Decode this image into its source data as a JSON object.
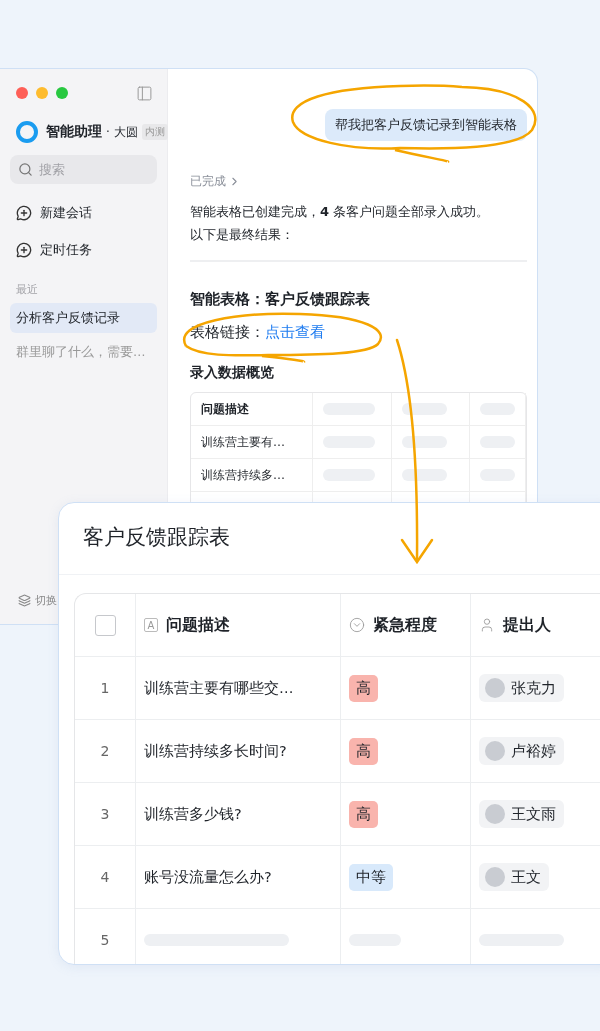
{
  "sidebar": {
    "app_name": "智能助理",
    "user": "· 大圆",
    "badge": "内测",
    "search": {
      "placeholder": "搜索"
    },
    "actions": [
      {
        "label": "新建会话"
      },
      {
        "label": "定时任务"
      }
    ],
    "section_title": "最近",
    "conversations": [
      {
        "label": "分析客户反馈记录",
        "selected": true
      },
      {
        "label": "群里聊了什么，需要…",
        "selected": false
      }
    ],
    "footer": "切换"
  },
  "chat": {
    "user_message": "帮我把客户反馈记录到智能表格",
    "status": "已完成",
    "reply_lines": [
      "智能表格已创建完成，**4** 条客户问题全部录入成功。",
      "以下是最终结果："
    ],
    "table_title": "智能表格：客户反馈跟踪表",
    "link_label": "表格链接：",
    "link_text": "点击查看",
    "overview_title": "录入数据概览",
    "overview_table": {
      "columns": [
        "问题描述"
      ],
      "rows": [
        "训练营主要有…",
        "训练营持续多…"
      ]
    }
  },
  "sheet": {
    "title": "客户反馈跟踪表",
    "select_all": {
      "checked": false
    },
    "columns": [
      {
        "label": "问题描述",
        "kind": "text",
        "type_glyph": "A"
      },
      {
        "label": "紧急程度",
        "kind": "select"
      },
      {
        "label": "提出人",
        "kind": "person"
      }
    ],
    "rows": [
      {
        "index": "1",
        "description": "训练营主要有哪些交…",
        "urgency": {
          "label": "高",
          "color": "#f9b4ad"
        },
        "person": "张克力"
      },
      {
        "index": "2",
        "description": "训练营持续多长时间?",
        "urgency": {
          "label": "高",
          "color": "#f9b4ad"
        },
        "person": "卢裕婷"
      },
      {
        "index": "3",
        "description": "训练营多少钱?",
        "urgency": {
          "label": "高",
          "color": "#f9b4ad"
        },
        "person": "王文雨"
      },
      {
        "index": "4",
        "description": "账号没流量怎么办?",
        "urgency": {
          "label": "中等",
          "color": "#d8e9fb"
        },
        "person": "王文"
      },
      {
        "index": "5"
      }
    ]
  }
}
